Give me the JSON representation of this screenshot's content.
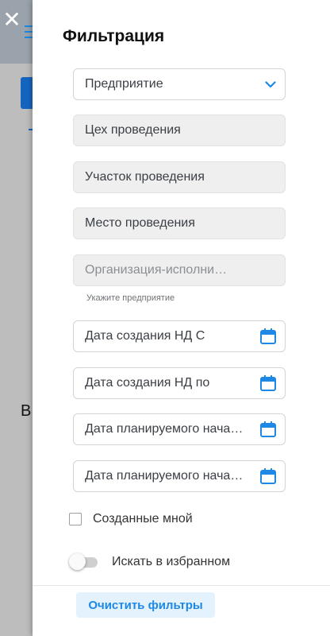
{
  "drawer": {
    "title": "Фильтрация",
    "fields": {
      "enterprise": "Предприятие",
      "workshop": "Цех проведения",
      "section": "Участок проведения",
      "location": "Место проведения",
      "contractor_placeholder": "Организация-исполни…",
      "contractor_hint": "Укажите предприятие",
      "created_from": "Дата создания НД С",
      "created_to": "Дата создания НД по",
      "planned_start_from": "Дата планируемого нача…",
      "planned_start_to": "Дата планируемого нача…"
    },
    "created_by_me_label": "Созданные мной",
    "search_favorites_label": "Искать в избранном",
    "clear_filters_label": "Очистить фильтры"
  },
  "background": {
    "partial_letter": "В"
  },
  "colors": {
    "accent": "#1e88e5",
    "field_filled_bg": "#efefef"
  },
  "icons": {
    "close": "close-icon",
    "dropdown": "chevron-down-icon",
    "date": "calendar-icon",
    "menu": "hamburger-icon"
  }
}
